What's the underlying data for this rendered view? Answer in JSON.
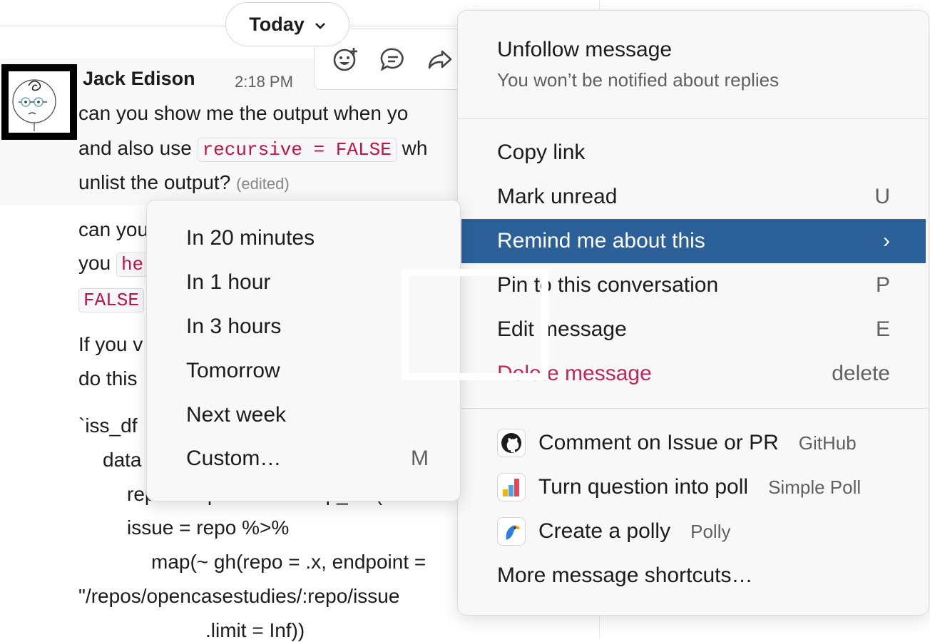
{
  "date_pill": {
    "label": "Today",
    "chevron": "chevron-down-icon"
  },
  "message": {
    "sender": "Jack Edison",
    "time": "2:18 PM",
    "line1": "can you show me the output when yo",
    "line2_pre": "and also  use ",
    "line2_code": "recursive = FALSE",
    "line2_post": " wh",
    "line3": "unlist the output?",
    "edited": "(edited)"
  },
  "message2": {
    "line1": "can you",
    "line2_pre": "you ",
    "line2_code": "he",
    "line3_code": "FALSE",
    "line4": "If you v",
    "line5": "do this",
    "line6": "`iss_df",
    "line7": "data",
    "line8": "repo = repos %>% map_chr(~ nam",
    "line9": "issue = repo %>%",
    "line10": "map(~ gh(repo = .x, endpoint =",
    "line11": "\"/repos/opencasestudies/:repo/issue",
    "line12": ".limit = Inf))"
  },
  "message_actions": [
    "add-reaction-icon",
    "reply-thread-icon",
    "share-icon"
  ],
  "context_menu": {
    "title": "Unfollow message",
    "subtitle": "You won’t be notified about replies",
    "items": [
      {
        "label": "Copy link",
        "key": ""
      },
      {
        "label": "Mark unread",
        "key": "U"
      },
      {
        "label": "Remind me about this",
        "key": "›"
      },
      {
        "label": "Pin to this conversation",
        "key": "P"
      },
      {
        "label": "Edit message",
        "key": "E"
      },
      {
        "label": "Delete message",
        "key": "delete"
      }
    ],
    "apps": [
      {
        "label": "Comment on Issue or PR",
        "source": "GitHub",
        "icon": "github-icon"
      },
      {
        "label": "Turn question into poll",
        "source": "Simple Poll",
        "icon": "simple-poll-icon"
      },
      {
        "label": "Create a polly",
        "source": "Polly",
        "icon": "polly-icon"
      }
    ],
    "more": "More message shortcuts…"
  },
  "remind_submenu": {
    "items": [
      {
        "label": "In 20 minutes",
        "key": ""
      },
      {
        "label": "In 1 hour",
        "key": ""
      },
      {
        "label": "In 3 hours",
        "key": ""
      },
      {
        "label": "Tomorrow",
        "key": ""
      },
      {
        "label": "Next week",
        "key": ""
      },
      {
        "label": "Custom…",
        "key": "M"
      }
    ]
  },
  "colors": {
    "active_item": "#2b6099",
    "danger": "#c12659",
    "code": "#c01343"
  }
}
